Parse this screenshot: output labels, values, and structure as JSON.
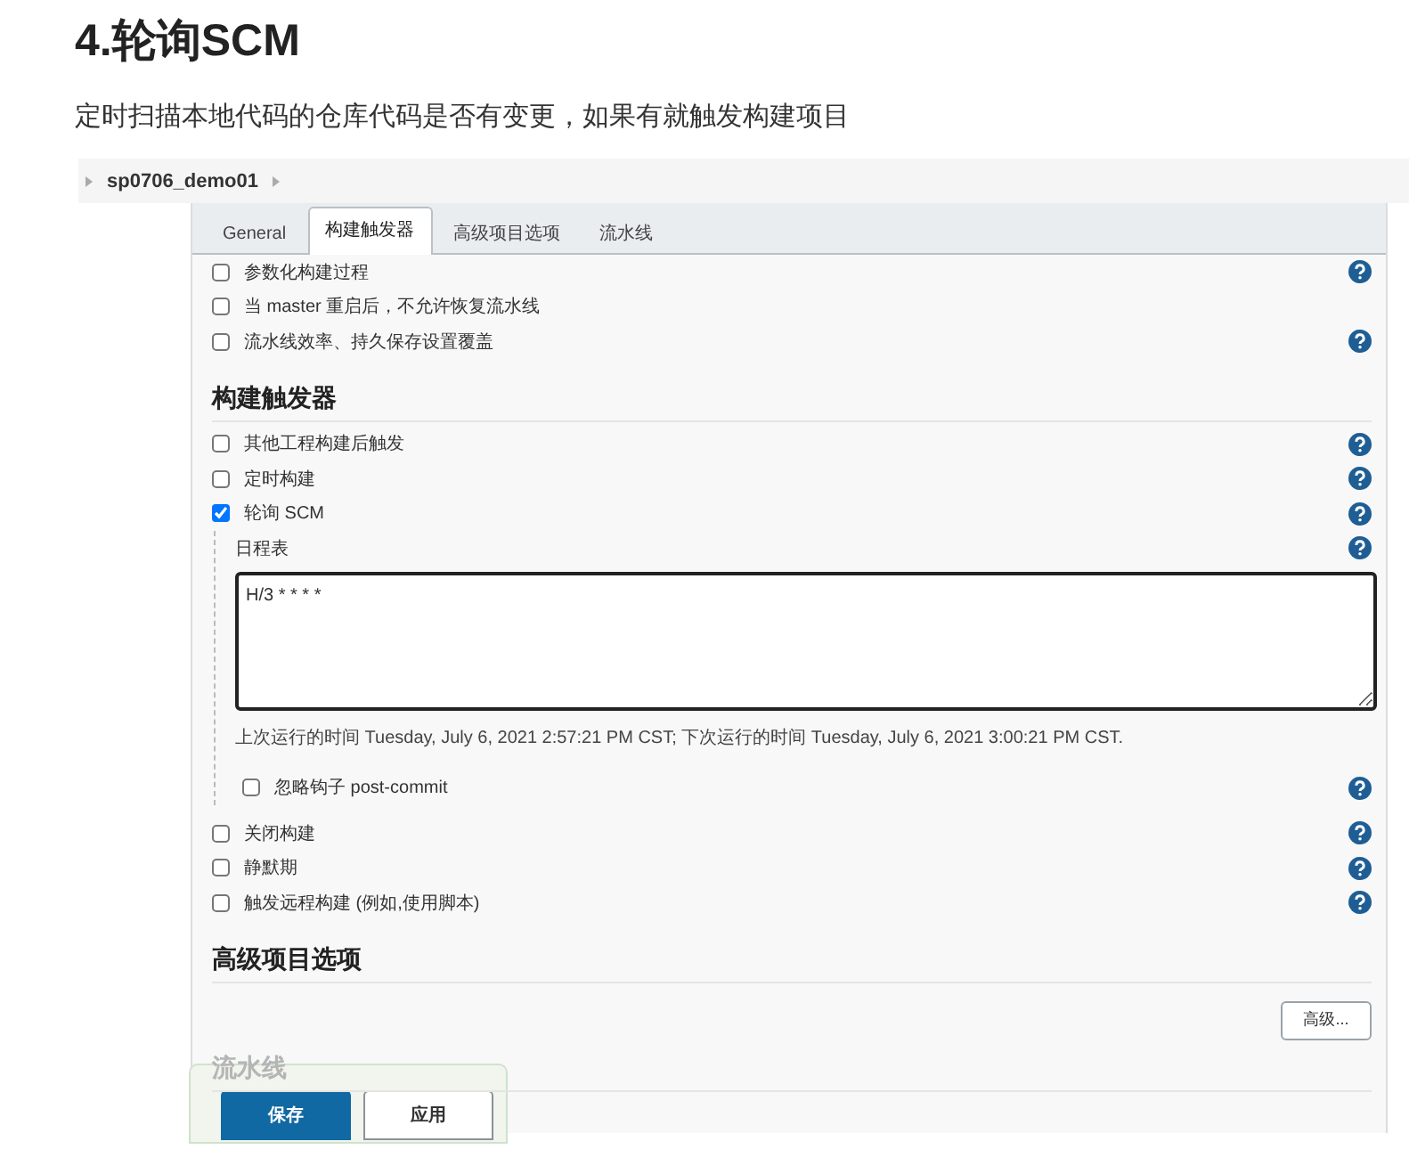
{
  "heading": "4.轮询SCM",
  "intro": "定时扫描本地代码的仓库代码是否有变更，如果有就触发构建项目",
  "breadcrumb": {
    "items": [
      "sp0706_demo01"
    ]
  },
  "tabs": [
    {
      "label": "General",
      "selected": false
    },
    {
      "label": "构建触发器",
      "selected": true
    },
    {
      "label": "高级项目选项",
      "selected": false
    },
    {
      "label": "流水线",
      "selected": false
    }
  ],
  "general_options": [
    {
      "label": "参数化构建过程",
      "checked": false,
      "help": true
    },
    {
      "label": "当 master 重启后，不允许恢复流水线",
      "checked": false,
      "help": false
    },
    {
      "label": "流水线效率、持久保存设置覆盖",
      "checked": false,
      "help": true
    }
  ],
  "triggers": {
    "title": "构建触发器",
    "options": [
      {
        "label": "其他工程构建后触发",
        "checked": false,
        "help": true
      },
      {
        "label": "定时构建",
        "checked": false,
        "help": true
      },
      {
        "label": "轮询 SCM",
        "checked": true,
        "help": true,
        "details": {
          "schedule_label": "日程表",
          "schedule_value": "H/3 * * * *",
          "schedule_note": "上次运行的时间 Tuesday, July 6, 2021 2:57:21 PM CST; 下次运行的时间 Tuesday, July 6, 2021 3:00:21 PM CST.",
          "sub_option": {
            "label": "忽略钩子 post-commit",
            "checked": false,
            "help": true
          }
        }
      },
      {
        "label": "关闭构建",
        "checked": false,
        "help": true
      },
      {
        "label": "静默期",
        "checked": false,
        "help": true
      },
      {
        "label": "触发远程构建 (例如,使用脚本)",
        "checked": false,
        "help": true
      }
    ]
  },
  "advanced": {
    "title": "高级项目选项",
    "button": "高级..."
  },
  "pipeline": {
    "title": "流水线"
  },
  "bottom_bar": {
    "buttons": [
      {
        "label": "保存",
        "kind": "primary"
      },
      {
        "label": "应用",
        "kind": "secondary"
      }
    ]
  }
}
